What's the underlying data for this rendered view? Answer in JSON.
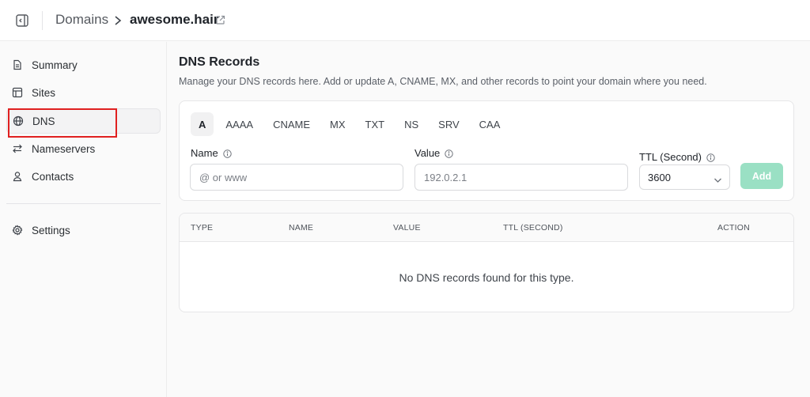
{
  "header": {
    "breadcrumb_root": "Domains",
    "breadcrumb_current": "awesome.hair"
  },
  "sidebar": {
    "items": [
      {
        "label": "Summary",
        "icon": "document-icon"
      },
      {
        "label": "Sites",
        "icon": "layout-icon"
      },
      {
        "label": "DNS",
        "icon": "globe-icon",
        "active": true
      },
      {
        "label": "Nameservers",
        "icon": "arrows-swap-icon"
      },
      {
        "label": "Contacts",
        "icon": "user-icon"
      }
    ],
    "settings": {
      "label": "Settings",
      "icon": "gear-icon"
    }
  },
  "main": {
    "title": "DNS Records",
    "description": "Manage your DNS records here. Add or update A, CNAME, MX, and other records to point your domain where you need.",
    "tabs": [
      "A",
      "AAAA",
      "CNAME",
      "MX",
      "TXT",
      "NS",
      "SRV",
      "CAA"
    ],
    "active_tab": "A",
    "form": {
      "name_label": "Name",
      "name_placeholder": "@ or www",
      "value_label": "Value",
      "value_placeholder": "192.0.2.1",
      "ttl_label": "TTL (Second)",
      "ttl_value": "3600",
      "add_label": "Add"
    },
    "table": {
      "columns": [
        "TYPE",
        "NAME",
        "VALUE",
        "TTL (SECOND)",
        "ACTION"
      ],
      "empty_message": "No DNS records found for this type."
    }
  },
  "colors": {
    "add_button": "#9ae0c4",
    "highlight_box": "#e02020"
  }
}
